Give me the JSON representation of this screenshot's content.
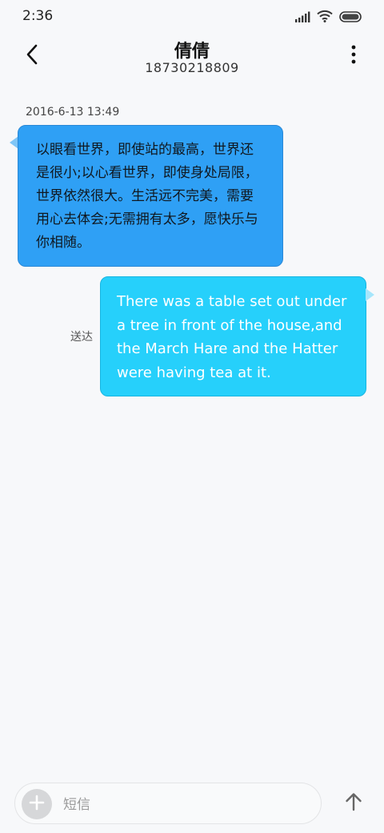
{
  "status_bar": {
    "time": "2:36",
    "icons": [
      "signal-icon",
      "wifi-icon",
      "battery-icon"
    ]
  },
  "header": {
    "contact_name": "倩倩",
    "phone_number": "18730218809",
    "back_icon": "back-arrow-icon",
    "more_icon": "more-vertical-icon"
  },
  "conversation": {
    "timestamp": "2016-6-13 13:49",
    "messages": [
      {
        "direction": "incoming",
        "text": "以眼看世界，即使站的最高，世界还是很小;以心看世界，即使身处局限，世界依然很大。生活远不完美，需要用心去体会;无需拥有太多，愿快乐与你相随。",
        "color": "#2fa0f5"
      },
      {
        "direction": "outgoing",
        "text": "There was a table set out under a tree in front of the house,and the March Hare and the Hatter were having tea at it.",
        "status": "送达",
        "color": "#26d0fb"
      }
    ]
  },
  "composer": {
    "placeholder": "短信",
    "value": "",
    "add_icon": "plus-icon",
    "send_icon": "send-arrow-icon"
  },
  "colors": {
    "background": "#f7f8fa",
    "incoming_bubble": "#2fa0f5",
    "outgoing_bubble": "#26d0fb"
  }
}
